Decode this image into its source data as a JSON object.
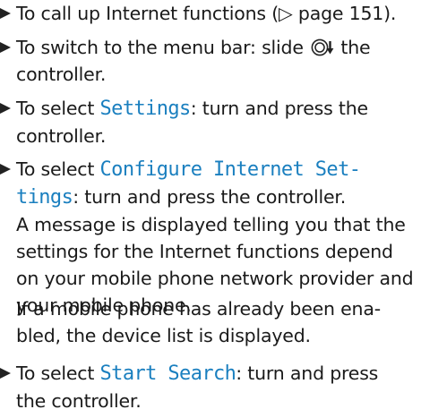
{
  "steps": [
    {
      "text": "To call up Internet functions (▷ page 151)."
    },
    {
      "part1": "To switch to the menu bar: slide",
      "part2": "the",
      "line2": "controller."
    },
    {
      "prefix": "To select ",
      "term": "Settings",
      "suffix": ": turn and press the",
      "line2": "controller."
    },
    {
      "prefix": "To select ",
      "term_part1": "Configure Internet Set-",
      "term_part2": "tings",
      "suffix": ": turn and press the controller.",
      "message_lines": [
        "A message is displayed telling you that the",
        "settings for the Internet functions depend",
        "on your mobile phone network provider and",
        "your mobile phone."
      ]
    }
  ],
  "note_lines": [
    "If a mobile phone has already been ena-",
    "bled, the device list is displayed."
  ],
  "step_last": {
    "prefix": "To select ",
    "term": "Start Search",
    "suffix": ": turn and press",
    "line2": "the controller."
  },
  "icons": {
    "bullet": "triangle-bullet-icon",
    "controller": "controller-slide-down-icon"
  },
  "colors": {
    "display_text": "#1a7fbf",
    "body_text": "#1a1a1a"
  }
}
